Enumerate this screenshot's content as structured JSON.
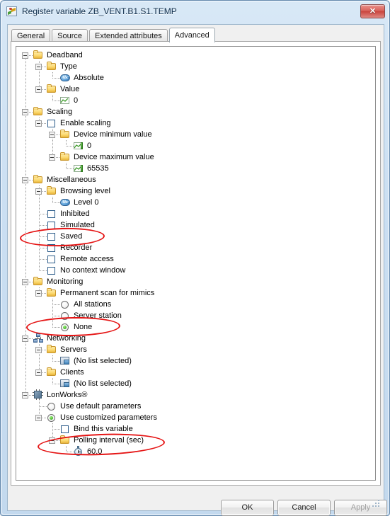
{
  "window": {
    "title": "Register variable ZB_VENT.B1.S1.TEMP",
    "icon": "variable-chart-icon",
    "close_label": "✕"
  },
  "tabs": [
    {
      "label": "General",
      "active": false
    },
    {
      "label": "Source",
      "active": false
    },
    {
      "label": "Extended attributes",
      "active": false
    },
    {
      "label": "Advanced",
      "active": true
    }
  ],
  "tree": [
    {
      "label": "Deadband",
      "icon": "folder-icon",
      "depth": 0,
      "expander": "minus"
    },
    {
      "label": "Type",
      "icon": "folder-icon",
      "depth": 1,
      "expander": "minus"
    },
    {
      "label": "Absolute",
      "icon": "abc-text-icon",
      "depth": 2,
      "expander": "leaf"
    },
    {
      "label": "Value",
      "icon": "folder-icon",
      "depth": 1,
      "expander": "minus"
    },
    {
      "label": "0",
      "icon": "chart-icon",
      "depth": 2,
      "expander": "leaf"
    },
    {
      "label": "Scaling",
      "icon": "folder-icon",
      "depth": 0,
      "expander": "minus"
    },
    {
      "label": "Enable scaling",
      "icon": "checkbox-unchecked-icon",
      "depth": 1,
      "expander": "minus"
    },
    {
      "label": "Device minimum value",
      "icon": "folder-icon",
      "depth": 2,
      "expander": "minus"
    },
    {
      "label": "0",
      "icon": "chart-value-icon",
      "depth": 3,
      "expander": "leaf"
    },
    {
      "label": "Device maximum value",
      "icon": "folder-icon",
      "depth": 2,
      "expander": "minus"
    },
    {
      "label": "65535",
      "icon": "chart-value-icon",
      "depth": 3,
      "expander": "leaf"
    },
    {
      "label": "Miscellaneous",
      "icon": "folder-icon",
      "depth": 0,
      "expander": "minus"
    },
    {
      "label": "Browsing level",
      "icon": "folder-icon",
      "depth": 1,
      "expander": "minus"
    },
    {
      "label": "Level 0",
      "icon": "abc-text-icon",
      "depth": 2,
      "expander": "leaf"
    },
    {
      "label": "Inhibited",
      "icon": "checkbox-unchecked-icon",
      "depth": 1,
      "expander": "leaf"
    },
    {
      "label": "Simulated",
      "icon": "checkbox-unchecked-icon",
      "depth": 1,
      "expander": "leaf"
    },
    {
      "label": "Saved",
      "icon": "checkbox-unchecked-icon",
      "depth": 1,
      "expander": "leaf"
    },
    {
      "label": "Recorder",
      "icon": "checkbox-unchecked-icon",
      "depth": 1,
      "expander": "leaf"
    },
    {
      "label": "Remote access",
      "icon": "checkbox-unchecked-icon",
      "depth": 1,
      "expander": "leaf"
    },
    {
      "label": "No context window",
      "icon": "checkbox-unchecked-icon",
      "depth": 1,
      "expander": "leaf"
    },
    {
      "label": "Monitoring",
      "icon": "folder-icon",
      "depth": 0,
      "expander": "minus"
    },
    {
      "label": "Permanent scan for mimics",
      "icon": "folder-icon",
      "depth": 1,
      "expander": "minus"
    },
    {
      "label": "All stations",
      "icon": "radio-unselected-icon",
      "depth": 2,
      "expander": "leaf"
    },
    {
      "label": "Server station",
      "icon": "radio-unselected-icon",
      "depth": 2,
      "expander": "leaf"
    },
    {
      "label": "None",
      "icon": "radio-selected-icon",
      "depth": 2,
      "expander": "leaf"
    },
    {
      "label": "Networking",
      "icon": "network-icon",
      "depth": 0,
      "expander": "minus"
    },
    {
      "label": "Servers",
      "icon": "folder-icon",
      "depth": 1,
      "expander": "minus"
    },
    {
      "label": "(No list selected)",
      "icon": "station-icon",
      "depth": 2,
      "expander": "leaf"
    },
    {
      "label": "Clients",
      "icon": "folder-icon",
      "depth": 1,
      "expander": "minus"
    },
    {
      "label": "(No list selected)",
      "icon": "station-icon",
      "depth": 2,
      "expander": "leaf"
    },
    {
      "label": "LonWorks®",
      "icon": "chip-icon",
      "depth": 0,
      "expander": "minus"
    },
    {
      "label": "Use default parameters",
      "icon": "radio-unselected-icon",
      "depth": 1,
      "expander": "leaf"
    },
    {
      "label": "Use customized parameters",
      "icon": "radio-selected-icon",
      "depth": 1,
      "expander": "minus"
    },
    {
      "label": "Bind this variable",
      "icon": "checkbox-unchecked-icon",
      "depth": 2,
      "expander": "leaf"
    },
    {
      "label": "Polling interval (sec)",
      "icon": "folder-icon",
      "depth": 2,
      "expander": "minus"
    },
    {
      "label": "60.0",
      "icon": "clock-icon",
      "depth": 3,
      "expander": "leaf"
    }
  ],
  "buttons": {
    "ok": "OK",
    "cancel": "Cancel",
    "apply": "Apply"
  },
  "annotations": [
    {
      "target": "Saved"
    },
    {
      "target": "None"
    },
    {
      "target": "Polling interval (sec)"
    }
  ],
  "colors": {
    "annotation": "#e51414",
    "folder": "#fcd96f",
    "radio_selected": "#43b32a",
    "title_text": "#0b2a48"
  }
}
